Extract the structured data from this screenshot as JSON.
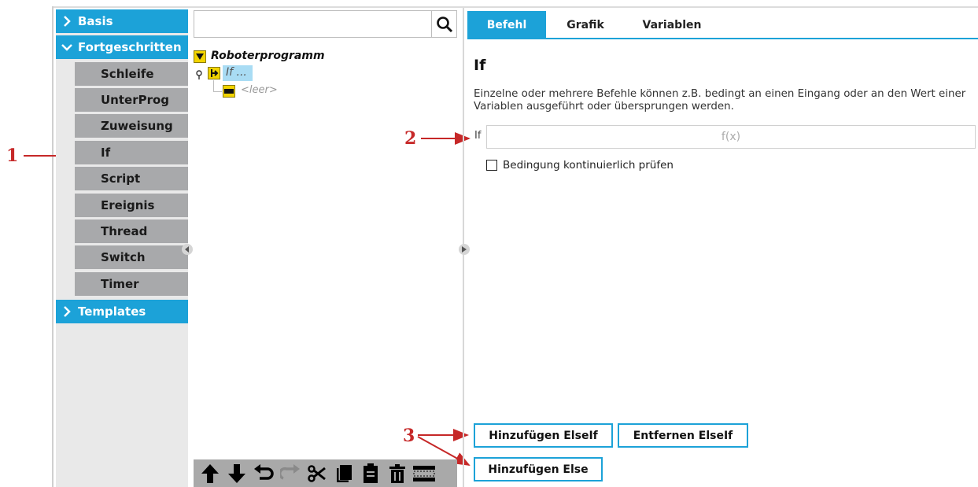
{
  "callouts": [
    "1",
    "2",
    "3"
  ],
  "sidebar": {
    "categories": [
      {
        "label": "Basis",
        "expanded": false
      },
      {
        "label": "Fortgeschritten",
        "expanded": true
      },
      {
        "label": "Templates",
        "expanded": false
      }
    ],
    "subitems": [
      "Schleife",
      "UnterProg",
      "Zuweisung",
      "If",
      "Script",
      "Ereignis",
      "Thread",
      "Switch",
      "Timer"
    ]
  },
  "tree": {
    "search_value": "",
    "root": "Roboterprogramm",
    "if_node": "If ...",
    "empty_node": "<leer>"
  },
  "toolbar": {
    "icons": [
      "move-up-icon",
      "move-down-icon",
      "undo-icon",
      "redo-icon",
      "cut-icon",
      "copy-icon",
      "paste-icon",
      "delete-icon",
      "suppress-icon"
    ]
  },
  "tabs": [
    "Befehl",
    "Grafik",
    "Variablen"
  ],
  "panel": {
    "title": "If",
    "description": "Einzelne oder mehrere Befehle können z.B. bedingt an einen Eingang oder an den Wert einer Variablen ausgeführt oder übersprungen werden.",
    "if_label": "If",
    "if_placeholder": "f(x)",
    "checkbox_label": "Bedingung kontinuierlich prüfen",
    "buttons": {
      "add_elseif": "Hinzufügen ElseIf",
      "remove_elseif": "Entfernen ElseIf",
      "add_else": "Hinzufügen Else"
    }
  },
  "colors": {
    "accent": "#1ca2d8",
    "subitem": "#a8a9ab",
    "node": "#f2d400",
    "callout": "#c62828"
  }
}
